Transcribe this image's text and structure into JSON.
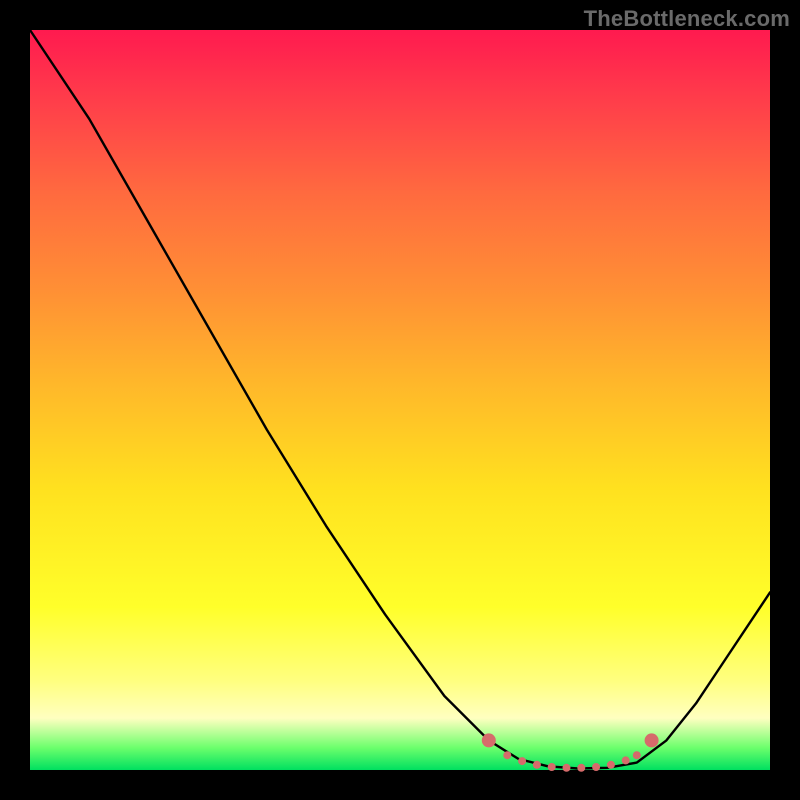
{
  "watermark": "TheBottleneck.com",
  "chart_data": {
    "type": "line",
    "title": "",
    "xlabel": "",
    "ylabel": "",
    "xlim": [
      0,
      1
    ],
    "ylim": [
      0,
      1
    ],
    "background_gradient": {
      "top_color": "#ff1a4f",
      "bottom_color": "#00e060"
    },
    "series": [
      {
        "name": "curve",
        "color": "#000000",
        "x": [
          0.0,
          0.08,
          0.16,
          0.24,
          0.32,
          0.4,
          0.48,
          0.56,
          0.62,
          0.66,
          0.7,
          0.74,
          0.78,
          0.82,
          0.86,
          0.9,
          0.94,
          1.0
        ],
        "y": [
          1.0,
          0.88,
          0.74,
          0.6,
          0.46,
          0.33,
          0.21,
          0.1,
          0.04,
          0.015,
          0.005,
          0.002,
          0.003,
          0.01,
          0.04,
          0.09,
          0.15,
          0.24
        ]
      }
    ],
    "markers": {
      "name": "points",
      "color": "#d66b6b",
      "radius_major": 7,
      "radius_minor": 4,
      "x": [
        0.62,
        0.645,
        0.665,
        0.685,
        0.705,
        0.725,
        0.745,
        0.765,
        0.785,
        0.805,
        0.82,
        0.84
      ],
      "y": [
        0.04,
        0.02,
        0.012,
        0.007,
        0.004,
        0.003,
        0.003,
        0.004,
        0.007,
        0.013,
        0.02,
        0.04
      ],
      "major_indices": [
        0,
        11
      ]
    }
  }
}
